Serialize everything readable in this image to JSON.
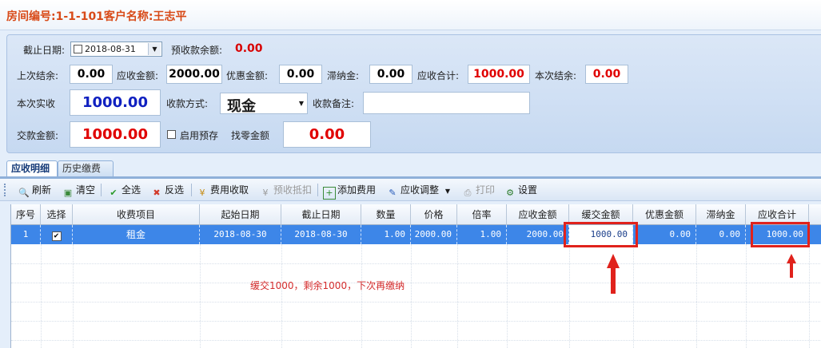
{
  "header": {
    "title": "房间编号:1-1-101客户名称:王志平"
  },
  "form": {
    "end_date_label": "截止日期:",
    "end_date_value": "2018-08-31",
    "prepaid_balance_label": "预收款余额:",
    "prepaid_balance_value": "0.00",
    "last_balance_label": "上次结余:",
    "last_balance_value": "0.00",
    "receivable_label": "应收金额:",
    "receivable_value": "2000.00",
    "discount_label": "优惠金额:",
    "discount_value": "0.00",
    "late_fee_label": "滞纳金:",
    "late_fee_value": "0.00",
    "total_receivable_label": "应收合计:",
    "total_receivable_value": "1000.00",
    "current_balance_label": "本次结余:",
    "current_balance_value": "0.00",
    "actual_received_label": "本次实收",
    "actual_received_value": "1000.00",
    "payment_method_label": "收款方式:",
    "payment_method_value": "现金",
    "payment_note_label": "收款备注:",
    "payment_note_value": "",
    "paid_amount_label": "交款金额:",
    "paid_amount_value": "1000.00",
    "enable_prepaid_label": "启用预存",
    "change_label": "找零金额",
    "change_value": "0.00"
  },
  "tabs": [
    {
      "label": "应收明细",
      "active": true
    },
    {
      "label": "历史缴费",
      "active": false
    }
  ],
  "toolbar": {
    "refresh": "刷新",
    "clear": "清空",
    "select_all": "全选",
    "invert": "反选",
    "fee_collect": "费用收取",
    "prepaid_offset": "预收抵扣",
    "add_fee": "添加费用",
    "adjust": "应收调整",
    "print": "打印",
    "settings": "设置"
  },
  "table": {
    "columns": [
      "序号",
      "选择",
      "收费项目",
      "起始日期",
      "截止日期",
      "数量",
      "价格",
      "倍率",
      "应收金额",
      "缓交金额",
      "优惠金额",
      "滞纳金",
      "应收合计"
    ],
    "rows": [
      {
        "index": "1",
        "selected": true,
        "item": "租金",
        "start_date": "2018-08-30",
        "end_date": "2018-08-30",
        "quantity": "1.00",
        "price": "2000.00",
        "rate": "1.00",
        "receivable": "2000.00",
        "deferred": "1000.00",
        "discount": "0.00",
        "late_fee": "0.00",
        "total": "1000.00"
      }
    ]
  },
  "annotation": {
    "note": "缓交1000，剩余1000，下次再缴纳"
  },
  "colors": {
    "title": "#d84a18",
    "accent_red": "#e00000",
    "accent_blue": "#1020c0",
    "selection": "#3d86e8",
    "highlight": "#e0221c"
  }
}
